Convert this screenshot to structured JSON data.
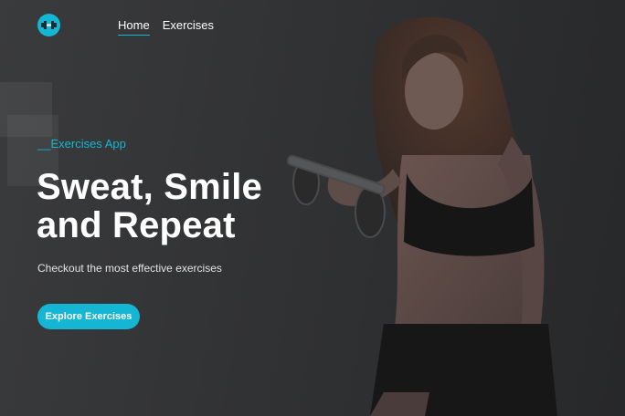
{
  "nav": {
    "logo_icon": "dumbbell-icon",
    "links": [
      {
        "label": "Home",
        "active": true
      },
      {
        "label": "Exercises",
        "active": false
      }
    ]
  },
  "hero": {
    "eyebrow": "__Exercises App",
    "headline_line1": "Sweat, Smile",
    "headline_line2": "and Repeat",
    "subtext": "Checkout the most effective exercises",
    "cta_label": "Explore Exercises"
  },
  "colors": {
    "accent": "#14b6d4",
    "background": "#2b2c2e",
    "text": "#ffffff"
  }
}
